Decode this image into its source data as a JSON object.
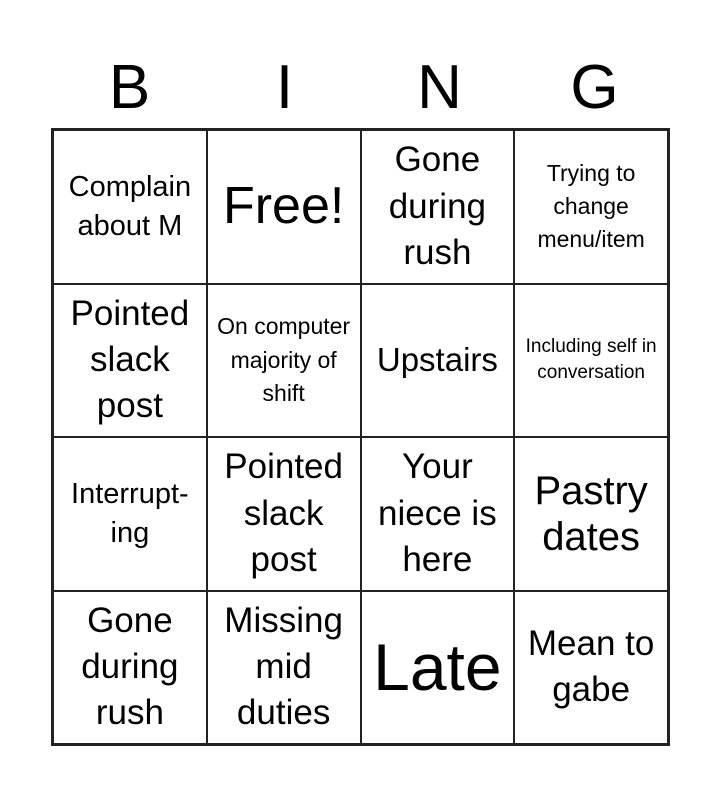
{
  "header": {
    "letters": [
      "B",
      "I",
      "N",
      "G"
    ]
  },
  "cells": [
    "Complain about M",
    "Free!",
    "Gone during rush",
    "Trying to change menu/item",
    "Pointed slack post",
    "On computer majority of shift",
    "Upstairs",
    "Including self in conversation",
    "Interrupt-ing",
    "Pointed slack post",
    "Your niece is here",
    "Pastry dates",
    "Gone during rush",
    "Missing mid duties",
    "Late",
    "Mean to gabe"
  ]
}
